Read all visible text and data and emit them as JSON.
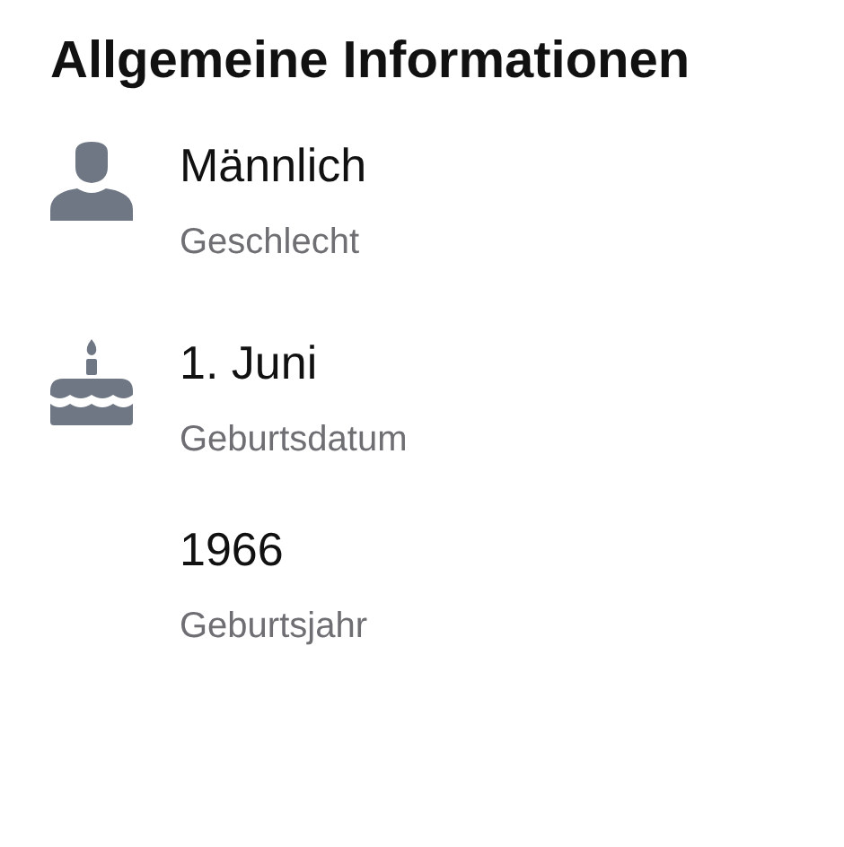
{
  "title": "Allgemeine Informationen",
  "items": [
    {
      "kind": "gender",
      "value": "Männlich",
      "label": "Geschlecht"
    },
    {
      "kind": "birthday",
      "value": "1. Juni",
      "label": "Geburtsdatum"
    },
    {
      "kind": "year",
      "value": "1966",
      "label": "Geburtsjahr"
    }
  ]
}
